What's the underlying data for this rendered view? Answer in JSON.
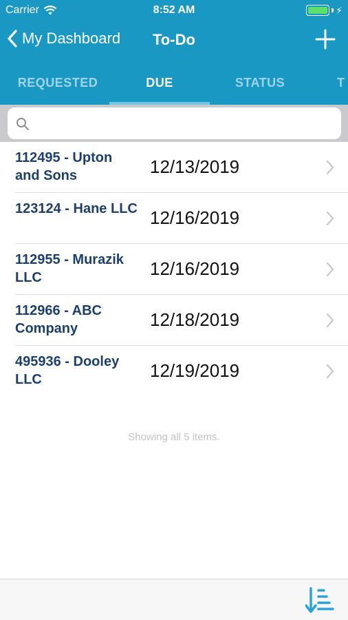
{
  "status_bar": {
    "carrier": "Carrier",
    "time": "8:52 AM",
    "battery_color": "#5de06b"
  },
  "nav": {
    "back_label": "My Dashboard",
    "title": "To-Do",
    "add_icon": "plus-icon"
  },
  "tabs": [
    {
      "label": "REQUESTED",
      "active": false
    },
    {
      "label": "DUE",
      "active": true
    },
    {
      "label": "STATUS",
      "active": false
    },
    {
      "label": "T",
      "active": false
    }
  ],
  "search": {
    "value": "",
    "placeholder": ""
  },
  "items": [
    {
      "title": "112495 - Upton and Sons",
      "date": "12/13/2019"
    },
    {
      "title": "123124 - Hane LLC",
      "date": "12/16/2019"
    },
    {
      "title": "112955 - Murazik LLC",
      "date": "12/16/2019"
    },
    {
      "title": "112966 - ABC Company",
      "date": "12/18/2019"
    },
    {
      "title": "495936 - Dooley LLC",
      "date": "12/19/2019"
    }
  ],
  "footer": {
    "summary": "Showing all 5 items."
  },
  "toolbar": {
    "sort_icon": "sort-descending-icon"
  },
  "colors": {
    "header": "#1a98c4",
    "title_text": "#1b4070",
    "tab_inactive": "#9fd3e6",
    "tab_indicator": "#72c6e3",
    "accent": "#2aa3d6"
  }
}
